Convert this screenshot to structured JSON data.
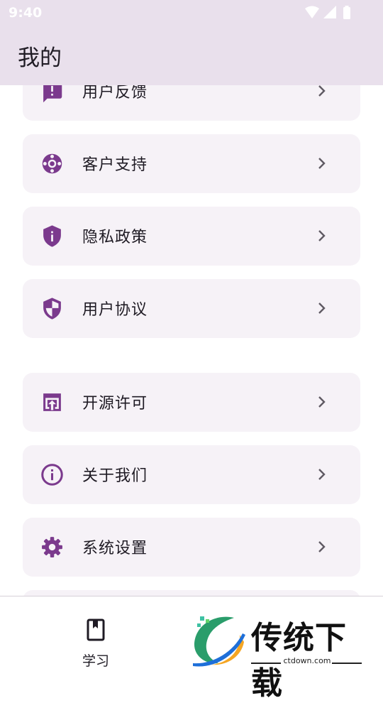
{
  "status": {
    "time": "9:40"
  },
  "appbar": {
    "title": "我的"
  },
  "menu": {
    "items": [
      {
        "label": "用户反馈",
        "icon": "feedback-icon"
      },
      {
        "label": "客户支持",
        "icon": "lifebuoy-icon"
      },
      {
        "label": "隐私政策",
        "icon": "shield-info-icon"
      },
      {
        "label": "用户协议",
        "icon": "shield-half-icon"
      },
      {
        "label": "开源许可",
        "icon": "open-in-new-icon"
      },
      {
        "label": "关于我们",
        "icon": "info-icon"
      },
      {
        "label": "系统设置",
        "icon": "gear-icon"
      }
    ]
  },
  "bottom_nav": {
    "study_label": "学习"
  },
  "watermark": {
    "brand": "传统下载",
    "url": "ctdown.com"
  },
  "colors": {
    "accent": "#7b3a8d",
    "card_bg": "#f6f2f7",
    "appbar_bg": "#e9e0ec"
  }
}
